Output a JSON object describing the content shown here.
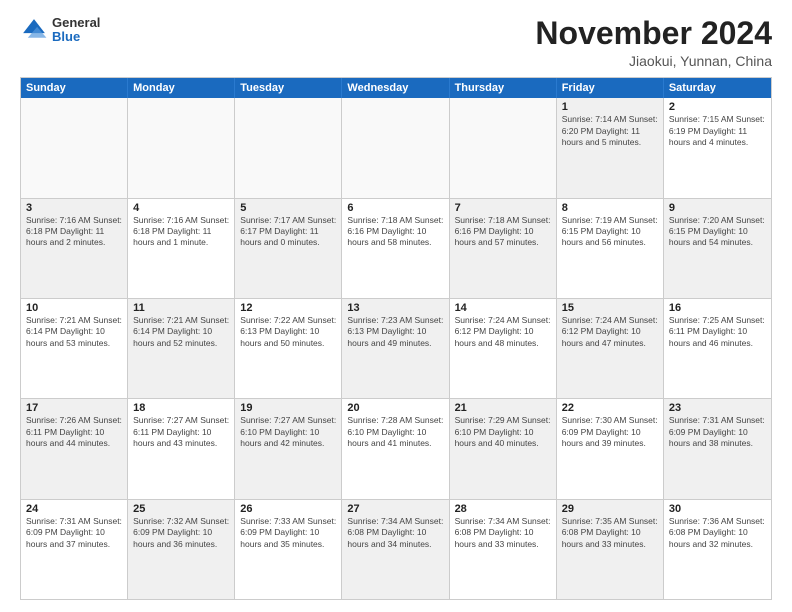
{
  "header": {
    "logo_general": "General",
    "logo_blue": "Blue",
    "title": "November 2024",
    "location": "Jiaokui, Yunnan, China"
  },
  "calendar": {
    "days_of_week": [
      "Sunday",
      "Monday",
      "Tuesday",
      "Wednesday",
      "Thursday",
      "Friday",
      "Saturday"
    ],
    "rows": [
      [
        {
          "day": "",
          "info": "",
          "empty": true
        },
        {
          "day": "",
          "info": "",
          "empty": true
        },
        {
          "day": "",
          "info": "",
          "empty": true
        },
        {
          "day": "",
          "info": "",
          "empty": true
        },
        {
          "day": "",
          "info": "",
          "empty": true
        },
        {
          "day": "1",
          "info": "Sunrise: 7:14 AM\nSunset: 6:20 PM\nDaylight: 11 hours and 5 minutes.",
          "shaded": true
        },
        {
          "day": "2",
          "info": "Sunrise: 7:15 AM\nSunset: 6:19 PM\nDaylight: 11 hours and 4 minutes.",
          "shaded": false
        }
      ],
      [
        {
          "day": "3",
          "info": "Sunrise: 7:16 AM\nSunset: 6:18 PM\nDaylight: 11 hours and 2 minutes.",
          "shaded": true
        },
        {
          "day": "4",
          "info": "Sunrise: 7:16 AM\nSunset: 6:18 PM\nDaylight: 11 hours and 1 minute.",
          "shaded": false
        },
        {
          "day": "5",
          "info": "Sunrise: 7:17 AM\nSunset: 6:17 PM\nDaylight: 11 hours and 0 minutes.",
          "shaded": true
        },
        {
          "day": "6",
          "info": "Sunrise: 7:18 AM\nSunset: 6:16 PM\nDaylight: 10 hours and 58 minutes.",
          "shaded": false
        },
        {
          "day": "7",
          "info": "Sunrise: 7:18 AM\nSunset: 6:16 PM\nDaylight: 10 hours and 57 minutes.",
          "shaded": true
        },
        {
          "day": "8",
          "info": "Sunrise: 7:19 AM\nSunset: 6:15 PM\nDaylight: 10 hours and 56 minutes.",
          "shaded": false
        },
        {
          "day": "9",
          "info": "Sunrise: 7:20 AM\nSunset: 6:15 PM\nDaylight: 10 hours and 54 minutes.",
          "shaded": true
        }
      ],
      [
        {
          "day": "10",
          "info": "Sunrise: 7:21 AM\nSunset: 6:14 PM\nDaylight: 10 hours and 53 minutes.",
          "shaded": false
        },
        {
          "day": "11",
          "info": "Sunrise: 7:21 AM\nSunset: 6:14 PM\nDaylight: 10 hours and 52 minutes.",
          "shaded": true
        },
        {
          "day": "12",
          "info": "Sunrise: 7:22 AM\nSunset: 6:13 PM\nDaylight: 10 hours and 50 minutes.",
          "shaded": false
        },
        {
          "day": "13",
          "info": "Sunrise: 7:23 AM\nSunset: 6:13 PM\nDaylight: 10 hours and 49 minutes.",
          "shaded": true
        },
        {
          "day": "14",
          "info": "Sunrise: 7:24 AM\nSunset: 6:12 PM\nDaylight: 10 hours and 48 minutes.",
          "shaded": false
        },
        {
          "day": "15",
          "info": "Sunrise: 7:24 AM\nSunset: 6:12 PM\nDaylight: 10 hours and 47 minutes.",
          "shaded": true
        },
        {
          "day": "16",
          "info": "Sunrise: 7:25 AM\nSunset: 6:11 PM\nDaylight: 10 hours and 46 minutes.",
          "shaded": false
        }
      ],
      [
        {
          "day": "17",
          "info": "Sunrise: 7:26 AM\nSunset: 6:11 PM\nDaylight: 10 hours and 44 minutes.",
          "shaded": true
        },
        {
          "day": "18",
          "info": "Sunrise: 7:27 AM\nSunset: 6:11 PM\nDaylight: 10 hours and 43 minutes.",
          "shaded": false
        },
        {
          "day": "19",
          "info": "Sunrise: 7:27 AM\nSunset: 6:10 PM\nDaylight: 10 hours and 42 minutes.",
          "shaded": true
        },
        {
          "day": "20",
          "info": "Sunrise: 7:28 AM\nSunset: 6:10 PM\nDaylight: 10 hours and 41 minutes.",
          "shaded": false
        },
        {
          "day": "21",
          "info": "Sunrise: 7:29 AM\nSunset: 6:10 PM\nDaylight: 10 hours and 40 minutes.",
          "shaded": true
        },
        {
          "day": "22",
          "info": "Sunrise: 7:30 AM\nSunset: 6:09 PM\nDaylight: 10 hours and 39 minutes.",
          "shaded": false
        },
        {
          "day": "23",
          "info": "Sunrise: 7:31 AM\nSunset: 6:09 PM\nDaylight: 10 hours and 38 minutes.",
          "shaded": true
        }
      ],
      [
        {
          "day": "24",
          "info": "Sunrise: 7:31 AM\nSunset: 6:09 PM\nDaylight: 10 hours and 37 minutes.",
          "shaded": false
        },
        {
          "day": "25",
          "info": "Sunrise: 7:32 AM\nSunset: 6:09 PM\nDaylight: 10 hours and 36 minutes.",
          "shaded": true
        },
        {
          "day": "26",
          "info": "Sunrise: 7:33 AM\nSunset: 6:09 PM\nDaylight: 10 hours and 35 minutes.",
          "shaded": false
        },
        {
          "day": "27",
          "info": "Sunrise: 7:34 AM\nSunset: 6:08 PM\nDaylight: 10 hours and 34 minutes.",
          "shaded": true
        },
        {
          "day": "28",
          "info": "Sunrise: 7:34 AM\nSunset: 6:08 PM\nDaylight: 10 hours and 33 minutes.",
          "shaded": false
        },
        {
          "day": "29",
          "info": "Sunrise: 7:35 AM\nSunset: 6:08 PM\nDaylight: 10 hours and 33 minutes.",
          "shaded": true
        },
        {
          "day": "30",
          "info": "Sunrise: 7:36 AM\nSunset: 6:08 PM\nDaylight: 10 hours and 32 minutes.",
          "shaded": false
        }
      ]
    ]
  }
}
